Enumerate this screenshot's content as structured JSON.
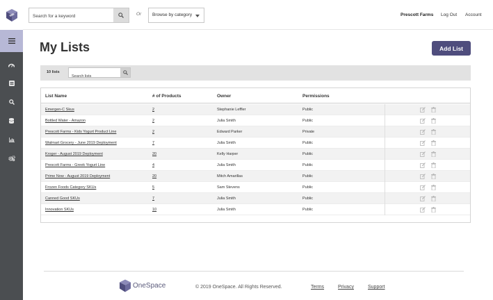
{
  "header": {
    "search_placeholder": "Search for a keyword",
    "or_label": "Or",
    "browse_label": "Browse by category",
    "nav": [
      "Prescott Farms",
      "Log Out",
      "Account"
    ]
  },
  "main": {
    "title": "My Lists",
    "add_button": "Add List",
    "list_count": "10 lists",
    "list_search_placeholder": "Search lists"
  },
  "table": {
    "columns": [
      "List Name",
      "# of Products",
      "Owner",
      "Permissions"
    ],
    "rows": [
      {
        "name": "Emergen-C Skus",
        "products": "2",
        "owner": "Stephanie Leffler",
        "permission": "Public"
      },
      {
        "name": "Bottled Water - Amazon",
        "products": "2",
        "owner": "Julia Smith",
        "permission": "Public"
      },
      {
        "name": "Prescott Farms - Kids Yogurt Product Line",
        "products": "2",
        "owner": "Edward Parker",
        "permission": "Private"
      },
      {
        "name": "Walmart Grocery - June 2019 Deployment",
        "products": "7",
        "owner": "Julia Smith",
        "permission": "Public"
      },
      {
        "name": "Kroger - August 2019 Deployment",
        "products": "20",
        "owner": "Kelly Harper",
        "permission": "Public"
      },
      {
        "name": "Prescott Farms - Greek Yogurt Line",
        "products": "4",
        "owner": "Julia Smith",
        "permission": "Public"
      },
      {
        "name": "Prime Now - August 2019 Deployment",
        "products": "20",
        "owner": "Mitch Amarillas",
        "permission": "Public"
      },
      {
        "name": "Frozen Foods Category SKUs",
        "products": "5",
        "owner": "Sam Stevens",
        "permission": "Public"
      },
      {
        "name": "Canned Good SKUs",
        "products": "7",
        "owner": "Julia Smith",
        "permission": "Public"
      },
      {
        "name": "Innovation SKUs",
        "products": "10",
        "owner": "Julia Smith",
        "permission": "Public"
      }
    ]
  },
  "footer": {
    "brand": "OneSpace",
    "copyright": "© 2019 OneSpace. All Rights Reserved.",
    "links": [
      "Terms",
      "Privacy",
      "Support"
    ]
  },
  "icons": {
    "sidebar": [
      "menu-icon",
      "dashboard-gauge-icon",
      "list-icon",
      "search-icon",
      "database-icon",
      "bar-chart-icon",
      "settings-gears-icon"
    ],
    "row_actions": [
      "edit-icon",
      "delete-icon"
    ]
  },
  "colors": {
    "sidebar": "#4b4e51",
    "sidebar_active": "#b7b8d6",
    "primary_button": "#4f4d7d",
    "toolbar": "#e2e2e2"
  }
}
